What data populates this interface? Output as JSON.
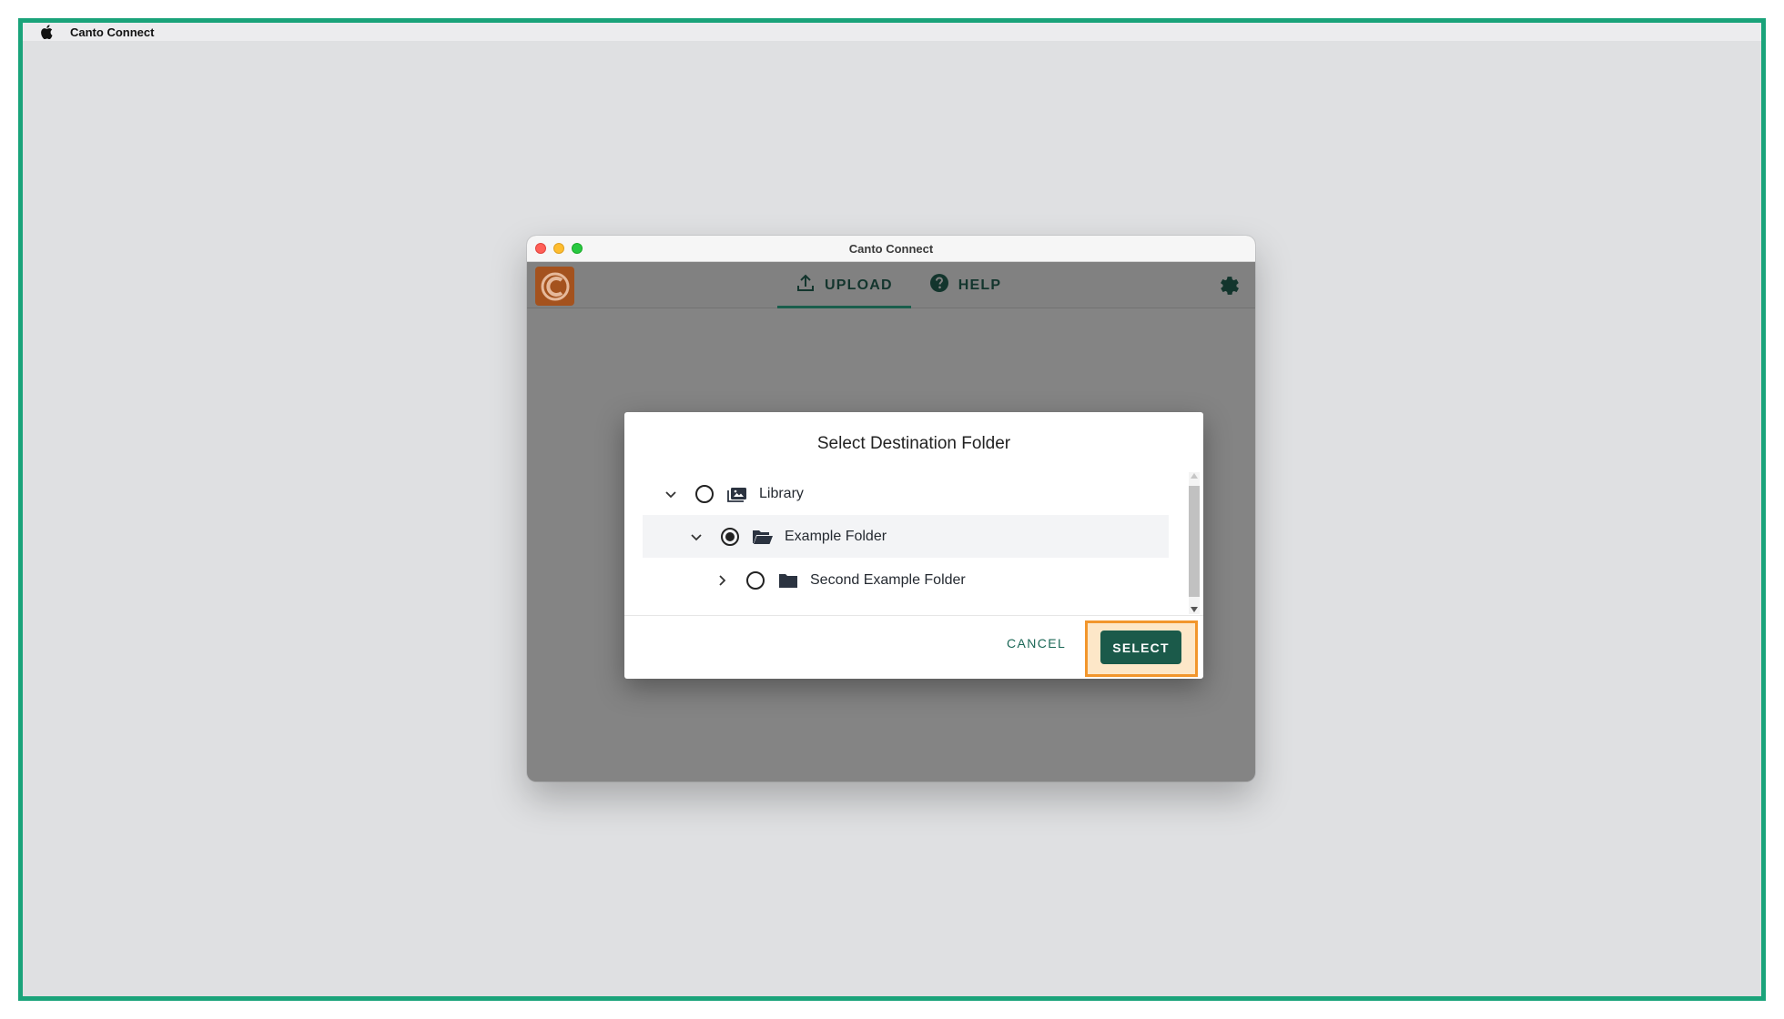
{
  "menubar": {
    "app_name": "Canto Connect"
  },
  "window": {
    "title": "Canto Connect"
  },
  "appbar": {
    "tabs": [
      {
        "label": "UPLOAD",
        "icon": "upload-icon",
        "active": true
      },
      {
        "label": "HELP",
        "icon": "help-icon",
        "active": false
      }
    ],
    "settings_icon": "gear-icon",
    "logo_icon": "canto-logo-icon"
  },
  "dialog": {
    "title": "Select Destination Folder",
    "tree": [
      {
        "label": "Library",
        "expanded": true,
        "checked": false,
        "icon": "library-icon",
        "depth": 0
      },
      {
        "label": "Example Folder",
        "expanded": true,
        "checked": true,
        "icon": "folder-open-icon",
        "depth": 1
      },
      {
        "label": "Second Example Folder",
        "expanded": false,
        "checked": false,
        "icon": "folder-icon",
        "depth": 2
      }
    ],
    "cancel_label": "CANCEL",
    "select_label": "SELECT"
  },
  "colors": {
    "frame": "#1aa37a",
    "primary": "#1b5a4a",
    "logo": "#a4521e",
    "highlight": "#f2962c"
  }
}
